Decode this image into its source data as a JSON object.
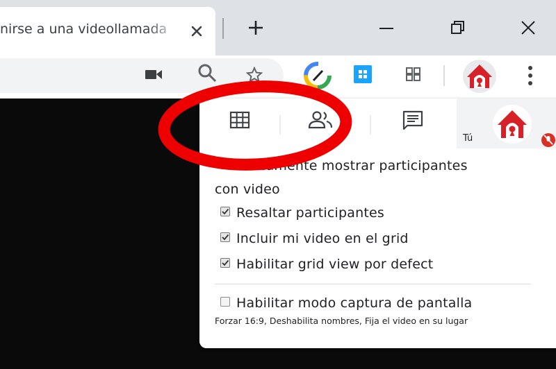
{
  "tab": {
    "title": "nirse a una videollamada"
  },
  "panel": {
    "you_label": "Tú",
    "options": [
      {
        "label": "Unicamente mostrar participantes",
        "label_cont": "con video",
        "checked": false
      },
      {
        "label": "Resaltar participantes",
        "checked": true
      },
      {
        "label": "Incluir mi video en el grid",
        "checked": true
      },
      {
        "label": "Habilitar grid view por defect",
        "checked": true
      }
    ],
    "capture_option": {
      "label": "Habilitar modo captura de pantalla",
      "checked": false
    },
    "capture_note": "Forzar 16:9, Deshabilita nombres, Fija el video en su lugar"
  },
  "icons": {
    "tab": [
      "close-icon",
      "new-tab-icon",
      "minimize-icon",
      "restore-icon",
      "window-close-icon"
    ],
    "toolbar": [
      "camera-icon",
      "search-icon",
      "star-icon",
      "extension-icon",
      "grid-extension-icon",
      "apps-icon",
      "profile-avatar-icon",
      "more-vert-icon"
    ],
    "panel": [
      "grid-view-icon",
      "participants-icon",
      "chat-icon",
      "user-avatar-icon",
      "mic-off-icon"
    ]
  },
  "colors": {
    "annotation_red": "#ee0000",
    "brand_red": "#d62128",
    "page_bg": "#0a0a0a"
  }
}
